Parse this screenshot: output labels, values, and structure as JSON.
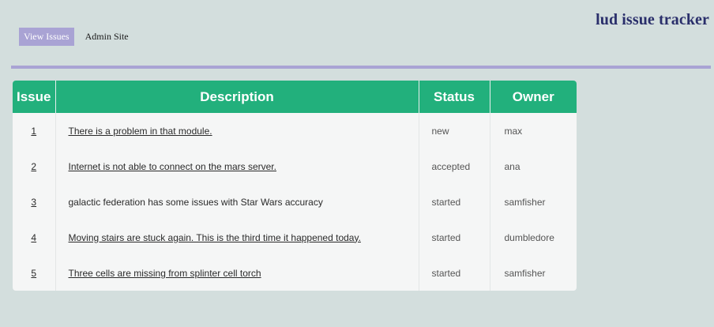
{
  "header": {
    "site_title": "lud issue tracker"
  },
  "nav": {
    "tabs": [
      {
        "label": "View Issues",
        "active": true
      },
      {
        "label": "Admin Site",
        "active": false
      }
    ]
  },
  "colors": {
    "background": "#d3dedd",
    "accent": "#a9a3d4",
    "table_header": "#22b07c",
    "title": "#2a2f6b"
  },
  "table": {
    "headers": {
      "issue": "Issue",
      "description": "Description",
      "status": "Status",
      "owner": "Owner"
    },
    "rows": [
      {
        "issue": "1",
        "description": "There is a problem in that module.",
        "status": "new",
        "owner": "max",
        "linked": true
      },
      {
        "issue": "2",
        "description": "Internet is not able to connect on the mars server.",
        "status": "accepted",
        "owner": "ana",
        "linked": true
      },
      {
        "issue": "3",
        "description": "galactic federation has some issues with Star Wars accuracy",
        "status": "started",
        "owner": "samfisher",
        "linked": false
      },
      {
        "issue": "4",
        "description": "Moving stairs are stuck again. This is the third time it happened today.",
        "status": "started",
        "owner": "dumbledore",
        "linked": true
      },
      {
        "issue": "5",
        "description": "Three cells are missing from splinter cell torch",
        "status": "started",
        "owner": "samfisher",
        "linked": true
      }
    ]
  }
}
